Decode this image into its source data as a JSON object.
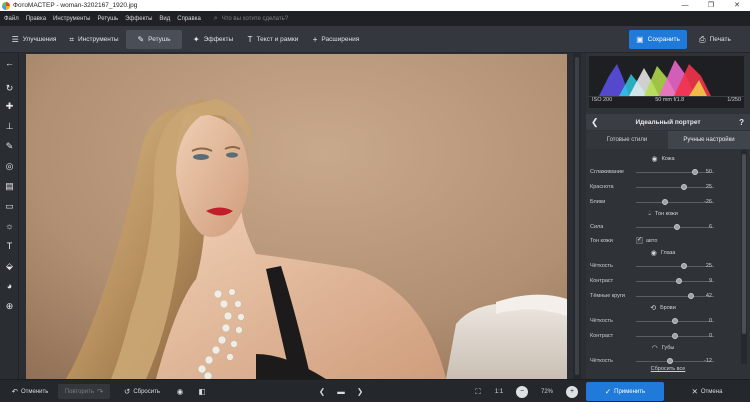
{
  "window": {
    "title": "ФотоМАСТЕР - woman-3202167_1920.jpg",
    "minimize": "—",
    "maximize": "❐",
    "close": "✕"
  },
  "menu": {
    "items": [
      "Файл",
      "Правка",
      "Инструменты",
      "Ретушь",
      "Эффекты",
      "Вид",
      "Справка"
    ],
    "search_placeholder": "Что вы хотите сделать?"
  },
  "toolbar": {
    "tabs": [
      {
        "label": "Улучшения",
        "icon": "☰"
      },
      {
        "label": "Инструменты",
        "icon": "⌗"
      },
      {
        "label": "Ретушь",
        "icon": "✎"
      },
      {
        "label": "Эффекты",
        "icon": "✦"
      },
      {
        "label": "Текст и рамки",
        "icon": "T"
      },
      {
        "label": "Расширения",
        "icon": "+"
      }
    ],
    "save_label": "Сохранить",
    "print_label": "Печать"
  },
  "histogram": {
    "iso": "ISO 200",
    "lens": "50 mm f/1.8",
    "shutter": "1/250"
  },
  "panel": {
    "title": "Идеальный портрет",
    "help": "?",
    "back": "❮",
    "tabs": [
      "Готовые стили",
      "Ручные настройки"
    ],
    "sections": {
      "skin": "Кожа",
      "skin_tone": "Тон кожи",
      "eyes": "Глаза",
      "brows": "Брови",
      "lips": "Губы"
    },
    "rows": {
      "smooth": {
        "label": "Сглаживание",
        "value": "50",
        "pos": 0.75
      },
      "redness": {
        "label": "Краснота",
        "value": "25",
        "pos": 0.62
      },
      "shine": {
        "label": "Блики",
        "value": "-26",
        "pos": 0.37
      },
      "strength": {
        "label": "Сила",
        "value": "6",
        "pos": 0.53
      },
      "skin_tone_check": {
        "label": "Тон кожи",
        "option": "авто",
        "mark": "✓"
      },
      "eye_clarity": {
        "label": "Чёткость",
        "value": "25",
        "pos": 0.62
      },
      "eye_contrast": {
        "label": "Контраст",
        "value": "9",
        "pos": 0.55
      },
      "dark_circles": {
        "label": "Тёмные круги",
        "value": "42",
        "pos": 0.71
      },
      "brow_clarity": {
        "label": "Чёткость",
        "value": "0",
        "pos": 0.5
      },
      "brow_contrast": {
        "label": "Контраст",
        "value": "0",
        "pos": 0.5
      },
      "lip_clarity": {
        "label": "Чёткость",
        "value": "-12",
        "pos": 0.44
      }
    },
    "reset_all": "Сбросить все"
  },
  "bottom": {
    "undo": "Отменить",
    "redo": "Повторить",
    "reset": "Сбросить",
    "ratio": "1:1",
    "zoom": "72%",
    "apply": "Применить",
    "cancel": "Отмена"
  }
}
